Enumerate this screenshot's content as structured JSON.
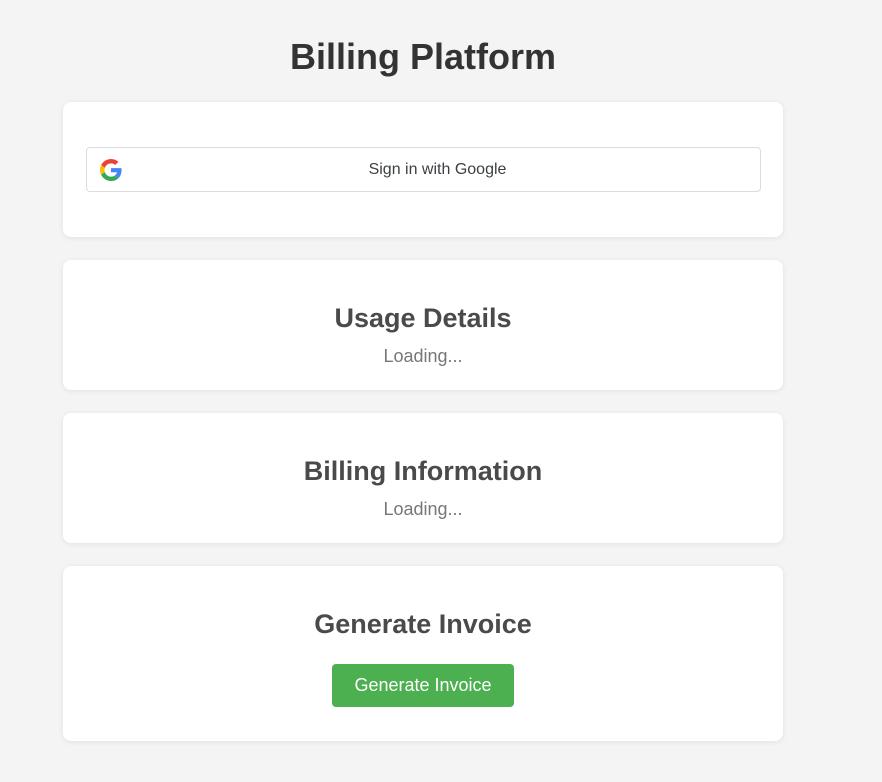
{
  "page": {
    "title": "Billing Platform"
  },
  "signin": {
    "button_label": "Sign in with Google",
    "icon": "google-logo-icon"
  },
  "usage": {
    "heading": "Usage Details",
    "status": "Loading..."
  },
  "billing": {
    "heading": "Billing Information",
    "status": "Loading..."
  },
  "invoice": {
    "heading": "Generate Invoice",
    "button_label": "Generate Invoice"
  },
  "colors": {
    "background": "#f4f4f4",
    "card": "#ffffff",
    "title": "#333333",
    "heading": "#4a4a4a",
    "muted": "#777777",
    "primary_button": "#4caf50",
    "google_blue": "#4285F4",
    "google_red": "#EA4335",
    "google_yellow": "#FBBC05",
    "google_green": "#34A853"
  }
}
